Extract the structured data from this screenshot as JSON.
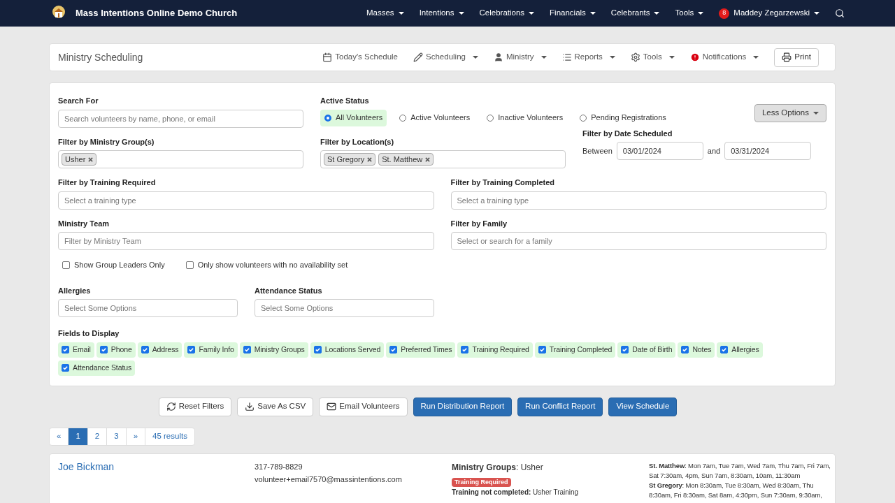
{
  "navbar": {
    "title": "Mass Intentions Online Demo Church",
    "menus": [
      "Masses",
      "Intentions",
      "Celebrations",
      "Financials",
      "Celebrants",
      "Tools"
    ],
    "notification_count": "8",
    "user": "Maddey Zegarzewski"
  },
  "header": {
    "title": "Ministry Scheduling",
    "menus": [
      {
        "label": "Today's Schedule",
        "dropdown": false
      },
      {
        "label": "Scheduling",
        "dropdown": true
      },
      {
        "label": "Ministry",
        "dropdown": true
      },
      {
        "label": "Reports",
        "dropdown": true
      },
      {
        "label": "Tools",
        "dropdown": true
      },
      {
        "label": "Notifications",
        "dropdown": true
      }
    ],
    "print": "Print"
  },
  "filters": {
    "search": {
      "label": "Search For",
      "placeholder": "Search volunteers by name, phone, or email"
    },
    "active_status": {
      "label": "Active Status",
      "options": [
        {
          "label": "All Volunteers",
          "selected": true
        },
        {
          "label": "Active Volunteers",
          "selected": false
        },
        {
          "label": "Inactive Volunteers",
          "selected": false
        },
        {
          "label": "Pending Registrations",
          "selected": false
        }
      ]
    },
    "less_options": "Less Options",
    "ministry_group": {
      "label": "Filter by Ministry Group(s)",
      "tags": [
        "Usher"
      ]
    },
    "location": {
      "label": "Filter by Location(s)",
      "tags": [
        "St Gregory",
        "St. Matthew"
      ]
    },
    "date": {
      "label": "Filter by Date Scheduled",
      "between": "Between",
      "from": "03/01/2024",
      "and": "and",
      "to": "03/31/2024"
    },
    "training_required": {
      "label": "Filter by Training Required",
      "placeholder": "Select a training type"
    },
    "training_completed": {
      "label": "Filter by Training Completed",
      "placeholder": "Select a training type"
    },
    "ministry_team": {
      "label": "Ministry Team",
      "placeholder": "Filter by Ministry Team"
    },
    "family": {
      "label": "Filter by Family",
      "placeholder": "Select or search for a family"
    },
    "checks": [
      {
        "label": "Show Group Leaders Only",
        "checked": false
      },
      {
        "label": "Only show volunteers with no availability set",
        "checked": false
      }
    ],
    "allergies": {
      "label": "Allergies",
      "placeholder": "Select Some Options"
    },
    "attendance": {
      "label": "Attendance Status",
      "placeholder": "Select Some Options"
    },
    "fields_label": "Fields to Display",
    "fields": [
      {
        "label": "Email",
        "checked": true
      },
      {
        "label": "Phone",
        "checked": true
      },
      {
        "label": "Address",
        "checked": true
      },
      {
        "label": "Family Info",
        "checked": true
      },
      {
        "label": "Ministry Groups",
        "checked": true
      },
      {
        "label": "Locations Served",
        "checked": true
      },
      {
        "label": "Preferred Times",
        "checked": true
      },
      {
        "label": "Training Required",
        "checked": true
      },
      {
        "label": "Training Completed",
        "checked": true
      },
      {
        "label": "Date of Birth",
        "checked": true
      },
      {
        "label": "Notes",
        "checked": true
      },
      {
        "label": "Allergies",
        "checked": true
      },
      {
        "label": "Attendance Status",
        "checked": true
      }
    ]
  },
  "actions": [
    {
      "label": "Reset Filters",
      "kind": "default"
    },
    {
      "label": "Save As CSV",
      "kind": "default"
    },
    {
      "label": "Email Volunteers",
      "kind": "default"
    },
    {
      "label": "Run Distribution Report",
      "kind": "primary"
    },
    {
      "label": "Run Conflict Report",
      "kind": "primary"
    },
    {
      "label": "View Schedule",
      "kind": "primary"
    }
  ],
  "pagination": {
    "prev": "«",
    "pages": [
      {
        "label": "1",
        "selected": true
      },
      {
        "label": "2",
        "selected": false
      },
      {
        "label": "3",
        "selected": false
      }
    ],
    "next": "»",
    "results": "45 results"
  },
  "volunteers": [
    {
      "name": "Joe Bickman",
      "phone": "317-789-8829",
      "email": "volunteer+email7570@massintentions.com",
      "groups": "**Ministry Groups**: Usher",
      "badge": "Training Required",
      "training": "**Training not completed:** Usher Training",
      "availability": [
        "**St. Matthew**: Mon 7am, Tue 7am, Wed 7am, Thu 7am, Fri 7am, Sat 7:30am, 4pm, Sun 7am, 8:30am, 10am, 11:30am",
        "**St Gregory**: Mon 8:30am, Tue 8:30am, Wed 8:30am, Thu 8:30am, Fri 8:30am, Sat 8am, 4:30pm, Sun 7:30am, 9:30am,"
      ]
    }
  ]
}
